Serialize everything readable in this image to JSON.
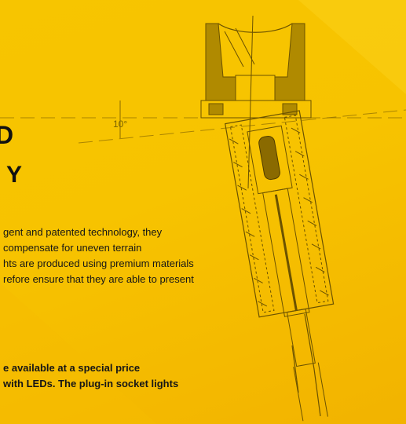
{
  "heading": {
    "line1": "D",
    "line2": "Y"
  },
  "angle_label": "10°",
  "paragraph1": [
    "gent and patented technology, they",
    "compensate for uneven terrain",
    "hts are produced using premium materials",
    "refore ensure that they are able to present"
  ],
  "paragraph2": [
    "e available at a special price",
    "with LEDs. The plug-in socket lights"
  ],
  "colors": {
    "background": "#f7c300",
    "drawing": "#8a6a00",
    "text": "#111111"
  }
}
